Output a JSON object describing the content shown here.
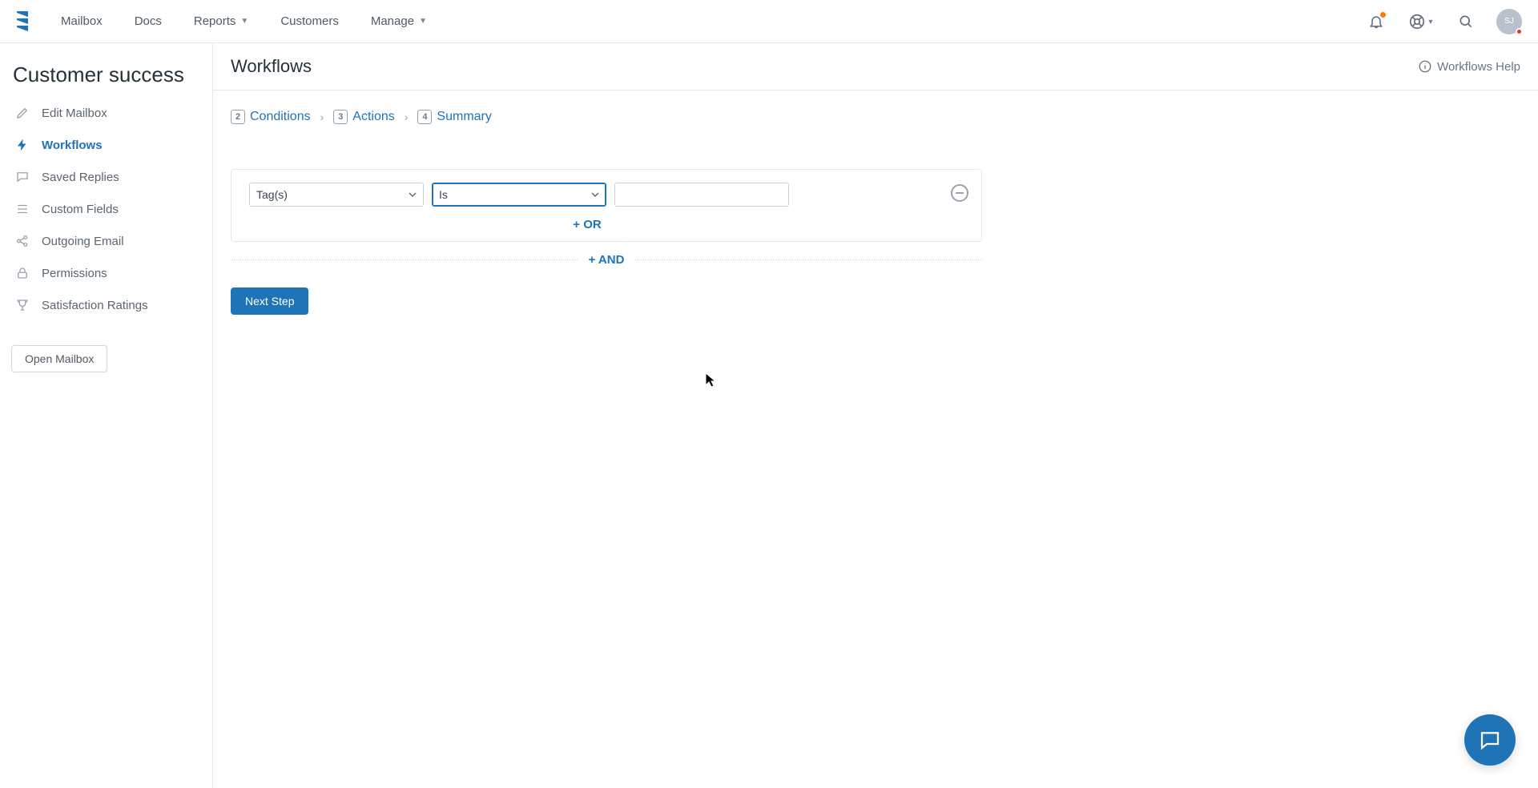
{
  "topnav": {
    "items": [
      "Mailbox",
      "Docs",
      "Reports",
      "Customers",
      "Manage"
    ],
    "has_caret": [
      false,
      false,
      true,
      false,
      true
    ],
    "avatar_initials": "SJ"
  },
  "sidebar": {
    "title": "Customer success",
    "items": [
      {
        "label": "Edit Mailbox",
        "icon": "pencil"
      },
      {
        "label": "Workflows",
        "icon": "bolt",
        "active": true
      },
      {
        "label": "Saved Replies",
        "icon": "chat"
      },
      {
        "label": "Custom Fields",
        "icon": "list"
      },
      {
        "label": "Outgoing Email",
        "icon": "share"
      },
      {
        "label": "Permissions",
        "icon": "lock"
      },
      {
        "label": "Satisfaction Ratings",
        "icon": "trophy"
      }
    ],
    "open_mailbox": "Open Mailbox"
  },
  "page": {
    "title": "Workflows",
    "help_label": "Workflows Help"
  },
  "steps": [
    {
      "num": "2",
      "label": "Conditions"
    },
    {
      "num": "3",
      "label": "Actions"
    },
    {
      "num": "4",
      "label": "Summary"
    }
  ],
  "condition": {
    "field_value": "Tag(s)",
    "operator_value": "Is",
    "add_or": "+ OR",
    "add_and": "+ AND"
  },
  "next_step": "Next Step"
}
